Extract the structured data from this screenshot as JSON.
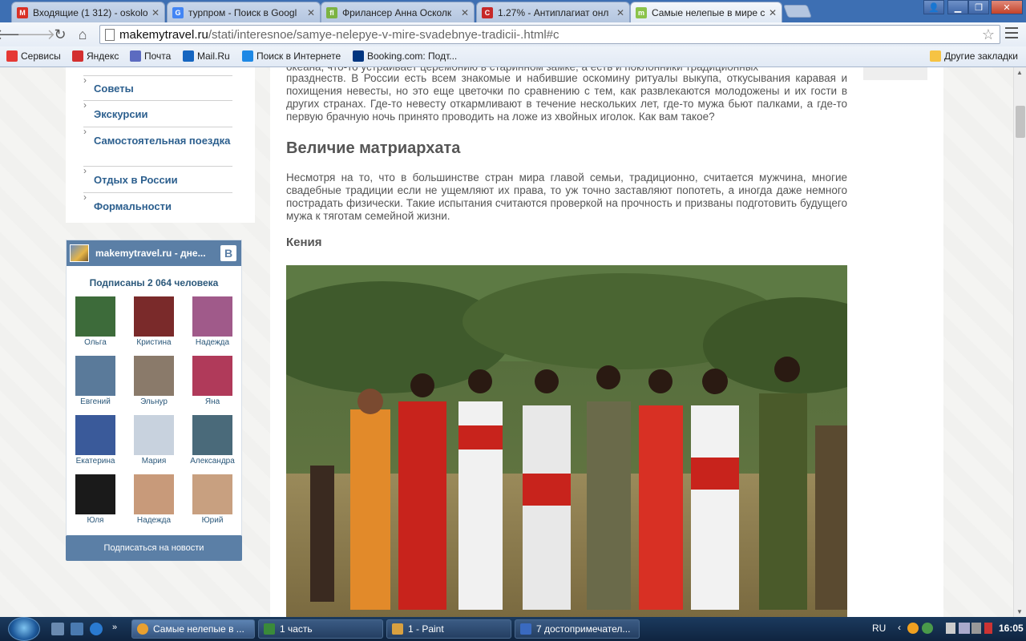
{
  "tabs": [
    {
      "title": "Входящие (1 312) - oskolo",
      "favicon": "M",
      "color": "#d93025"
    },
    {
      "title": "турпром - Поиск в Googl",
      "favicon": "G",
      "color": "#4285f4"
    },
    {
      "title": "Фрилансер Анна Осколк",
      "favicon": "fl",
      "color": "#7cb342"
    },
    {
      "title": "1.27% - Антиплагиат онл",
      "favicon": "C",
      "color": "#c62828"
    },
    {
      "title": "Самые нелепые в мире с",
      "favicon": "m",
      "color": "#8bc34a"
    }
  ],
  "address": {
    "host": "makemytravel.ru",
    "path": "/stati/interesnoe/samye-nelepye-v-mire-svadebnye-tradicii-.html#c"
  },
  "bookmarks": [
    {
      "label": "Сервисы",
      "color": "#e53935"
    },
    {
      "label": "Яндекс",
      "color": "#d32f2f"
    },
    {
      "label": "Почта",
      "color": "#5c6bc0"
    },
    {
      "label": "Mail.Ru",
      "color": "#1565c0"
    },
    {
      "label": "Поиск в Интернете",
      "color": "#1e88e5"
    },
    {
      "label": "Booking.com: Подт...",
      "color": "#003580"
    },
    {
      "label": "Другие закладки",
      "color": "#f6c343"
    }
  ],
  "categories": [
    "Советы",
    "Экскурсии",
    "Самостоятельная поездка",
    "Отдых в России",
    "Формальности"
  ],
  "vk": {
    "group_name": "makemytravel.ru - дне...",
    "subscribers": "Подписаны 2 064 человека",
    "subscribe_btn": "Подписаться на новости",
    "members": [
      {
        "name": "Ольга",
        "color": "#3d6b3a"
      },
      {
        "name": "Кристина",
        "color": "#7a2a2a"
      },
      {
        "name": "Надежда",
        "color": "#a05a8a"
      },
      {
        "name": "Евгений",
        "color": "#5a7a9a"
      },
      {
        "name": "Эльнур",
        "color": "#8a7a6a"
      },
      {
        "name": "Яна",
        "color": "#b03a5a"
      },
      {
        "name": "Екатерина",
        "color": "#3a5a9a"
      },
      {
        "name": "Мария",
        "color": "#c8d2de"
      },
      {
        "name": "Александра",
        "color": "#4a6a7a"
      },
      {
        "name": "Юля",
        "color": "#1a1a1a"
      },
      {
        "name": "Надежда",
        "color": "#c89a7a"
      },
      {
        "name": "Юрий",
        "color": "#c8a080"
      }
    ]
  },
  "article": {
    "intro_partial": "океана, что-то устраивает церемонию в старинном замке, а есть и поклонники традиционных",
    "intro": "празднеств. В России есть всем знакомые и набившие оскомину ритуалы выкупа, откусывания каравая и похищения невесты, но это еще цветочки по сравнению с тем, как развлекаются молодожены и их гости в других странах. Где-то невесту откармливают в течение нескольких лет, где-то мужа бьют палками, а где-то первую брачную ночь принято проводить на ложе из хвойных иголок. Как вам такое?",
    "h2": "Величие матриархата",
    "para2": "Несмотря на то, что в большинстве стран мира главой семьи, традиционно, считается мужчина, многие свадебные традиции если не ущемляют их права, то уж точно заставляют попотеть, а иногда даже немного пострадать физически. Такие испытания считаются проверкой на прочность и призваны подготовить будущего мужа к тяготам семейной жизни.",
    "h3": "Кения"
  },
  "taskbar": {
    "tasks": [
      "Самые нелепые в ...",
      "1 часть",
      "1 - Paint",
      "7 достопримечател..."
    ],
    "lang": "RU",
    "time": "16:05"
  }
}
